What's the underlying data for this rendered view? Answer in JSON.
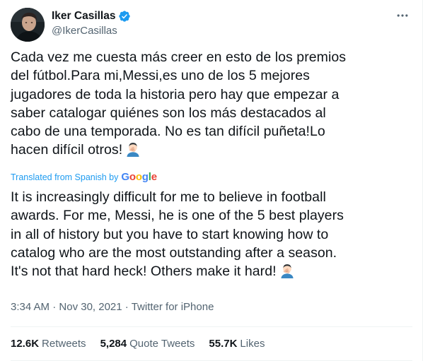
{
  "user": {
    "display_name": "Iker Casillas",
    "handle": "@IkerCasillas",
    "verified": true
  },
  "tweet": {
    "original_text": "Cada vez me cuesta más creer en esto de los premios\ndel fútbol.Para mi,Messi,es uno de los 5 mejores\njugadores de toda la historia pero hay que empezar a\nsaber catalogar quiénes son los más destacados al\ncabo de una temporada. No es tan difícil puñeta!Lo\nhacen difícil otros!",
    "translation_note": "Translated from Spanish by",
    "translation_provider": "Google",
    "translated_text": "It is increasingly difficult for me to believe in football\nawards. For me, Messi, he is one of the 5 best players\nin all of history but you have to start knowing how to\ncatalog who are the most outstanding after a season.\nIt's not that hard heck! Others make it hard!",
    "emoji": "face-palm-emoji"
  },
  "meta": {
    "time": "3:34 AM",
    "separator": "·",
    "date": "Nov 30, 2021",
    "source": "Twitter for iPhone"
  },
  "stats": {
    "retweets_count": "12.6K",
    "retweets_label": "Retweets",
    "quotes_count": "5,284",
    "quotes_label": "Quote Tweets",
    "likes_count": "55.7K",
    "likes_label": "Likes"
  },
  "colors": {
    "accent": "#1d9bf0",
    "text": "#0f1419",
    "secondary": "#536471",
    "divider": "#eff3f4"
  }
}
